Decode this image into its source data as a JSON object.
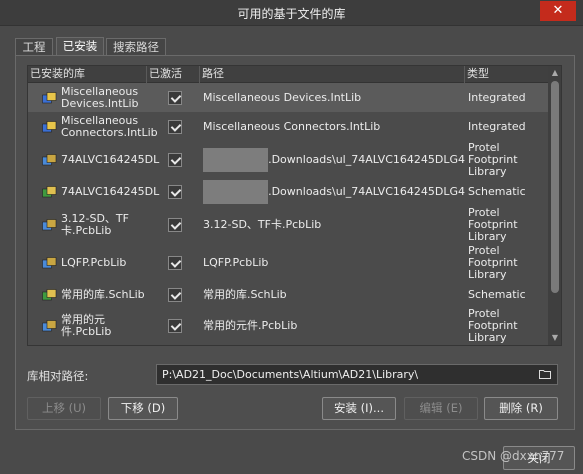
{
  "window": {
    "title": "可用的基于文件的库",
    "close_glyph": "✕"
  },
  "tabs": [
    {
      "label": "工程",
      "active": false
    },
    {
      "label": "已安装",
      "active": true
    },
    {
      "label": "搜索路径",
      "active": false
    }
  ],
  "table": {
    "headers": [
      "已安装的库",
      "已激活",
      "路径",
      "类型"
    ],
    "rows": [
      {
        "name": "Miscellaneous Devices.IntLib",
        "active": true,
        "path": "Miscellaneous Devices.IntLib",
        "type": "Integrated",
        "icon": "integrated-lib-icon",
        "selected": true
      },
      {
        "name": "Miscellaneous Connectors.IntLib",
        "active": true,
        "path": "Miscellaneous Connectors.IntLib",
        "type": "Integrated",
        "icon": "integrated-lib-icon",
        "selected": false
      },
      {
        "name": "74ALVC164245DL",
        "active": true,
        "path": ".Downloads\\ul_74ALVC164245DLG4",
        "type": "Protel Footprint Library",
        "icon": "pcb-lib-icon",
        "selected": false,
        "redacted": true
      },
      {
        "name": "74ALVC164245DL",
        "active": true,
        "path": ".Downloads\\ul_74ALVC164245DLG4",
        "type": "Schematic",
        "icon": "sch-lib-icon",
        "selected": false,
        "redacted": true
      },
      {
        "name": "3.12-SD、TF卡.PcbLib",
        "active": true,
        "path": "3.12-SD、TF卡.PcbLib",
        "type": "Protel Footprint Library",
        "icon": "pcb-lib-icon",
        "selected": false
      },
      {
        "name": "LQFP.PcbLib",
        "active": true,
        "path": "LQFP.PcbLib",
        "type": "Protel Footprint Library",
        "icon": "pcb-lib-icon",
        "selected": false
      },
      {
        "name": "常用的库.SchLib",
        "active": true,
        "path": "常用的库.SchLib",
        "type": "Schematic",
        "icon": "sch-lib-icon",
        "selected": false
      },
      {
        "name": "常用的元件.PcbLib",
        "active": true,
        "path": "常用的元件.PcbLib",
        "type": "Protel Footprint Library",
        "icon": "pcb-lib-icon",
        "selected": false
      }
    ]
  },
  "path_row": {
    "label": "库相对路径:",
    "value": "P:\\AD21_Doc\\Documents\\Altium\\AD21\\Library\\"
  },
  "buttons": {
    "move_up": "上移 (U)",
    "move_down": "下移 (D)",
    "install": "安装 (I)...",
    "edit": "编辑 (E)",
    "remove": "删除 (R)",
    "close": "关闭"
  },
  "watermark": "CSDN @dxxn777"
}
